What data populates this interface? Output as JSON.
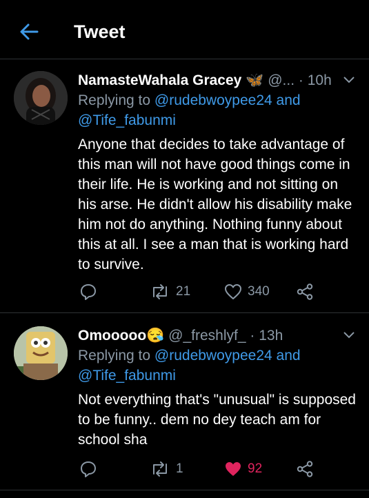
{
  "header": {
    "title": "Tweet",
    "back_icon": "arrow-left-icon"
  },
  "colors": {
    "accent": "#3f9ae8",
    "like_active": "#e0245e",
    "muted": "#8b98a5"
  },
  "tweets": [
    {
      "name": "NamasteWahala Gracey",
      "name_emoji": "🦋",
      "handle": "@...",
      "time": "10h",
      "reply_prefix": "Replying to",
      "reply_user1": "@rudebwoypee24",
      "reply_and": "and",
      "reply_user2": "@Tife_fabunmi",
      "text": "Anyone that decides to take advantage of this man will not have good things come in their life. He is working and not sitting on his arse. He didn't allow his disability make him not do anything. Nothing funny about this at all. I see a man that is working hard to survive.",
      "retweets": "21",
      "likes": "340",
      "liked": false
    },
    {
      "name": "Omooooo",
      "name_emoji": "😪",
      "handle": "@_freshlyf_",
      "time": "13h",
      "reply_prefix": "Replying to",
      "reply_user1": "@rudebwoypee24",
      "reply_and": "and",
      "reply_user2": "@Tife_fabunmi",
      "text": "Not everything that's \"unusual\" is supposed to be funny.. dem no dey teach am for school sha",
      "retweets": "1",
      "likes": "92",
      "liked": true
    }
  ]
}
